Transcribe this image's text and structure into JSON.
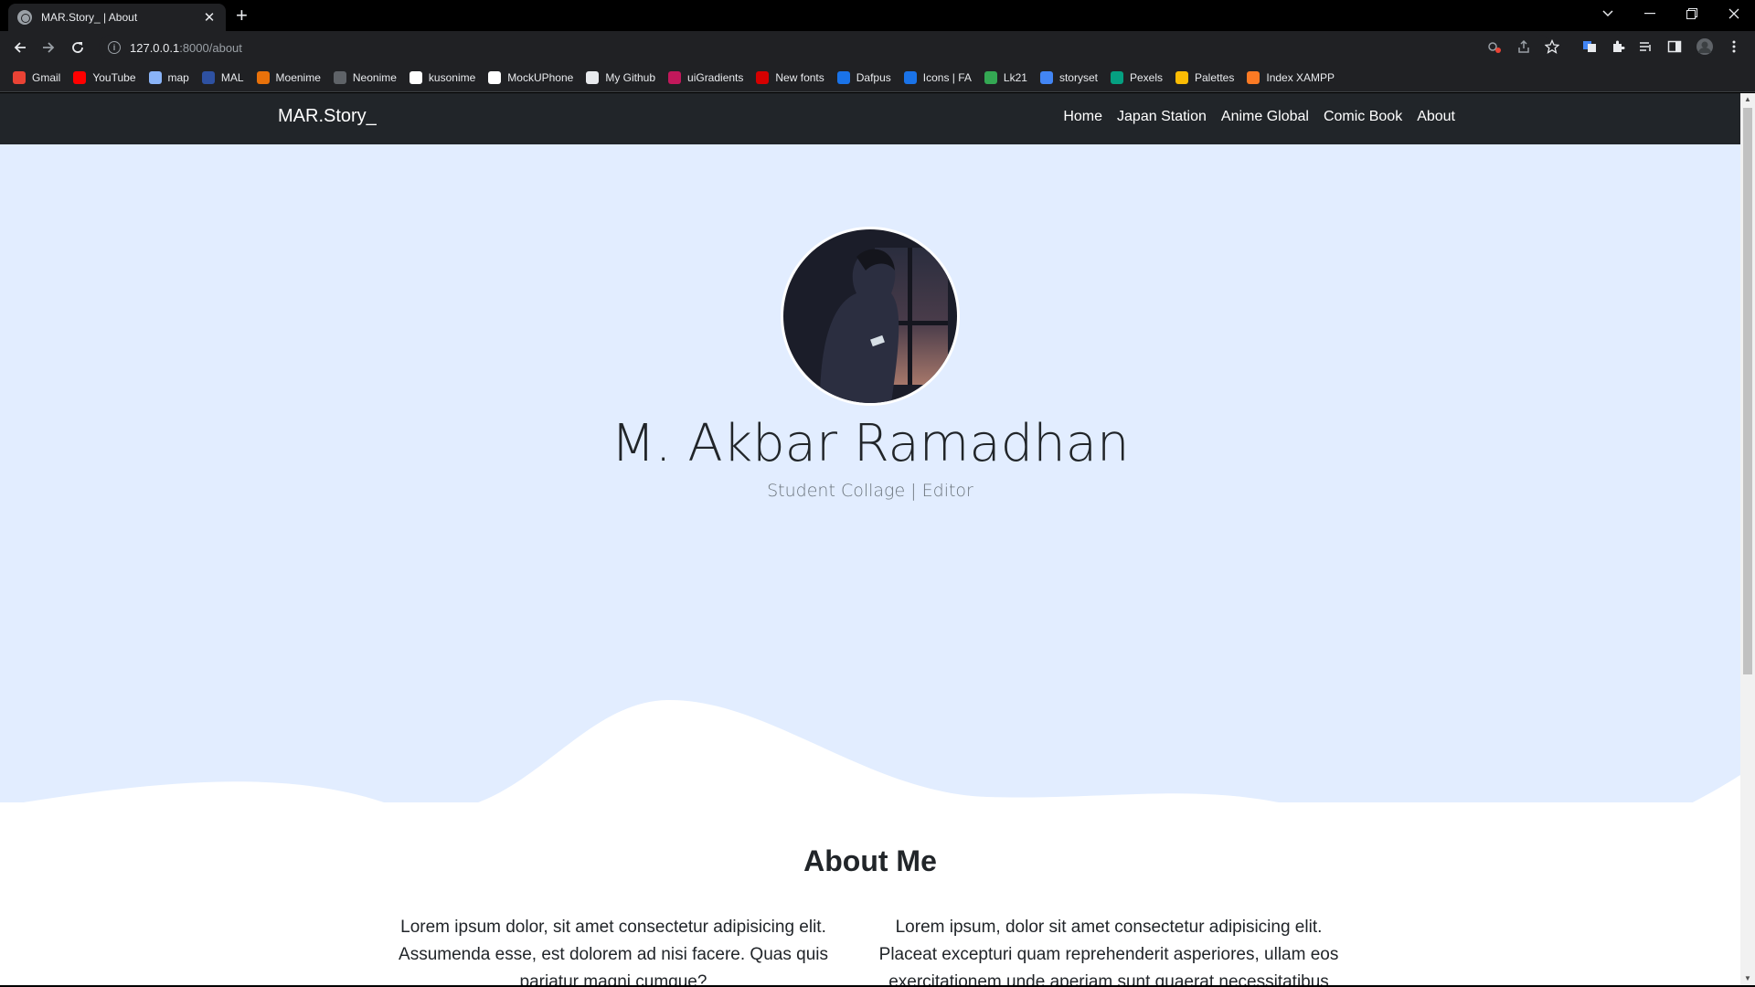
{
  "browser": {
    "tab_title": "MAR.Story_ | About",
    "tab_close": "✕",
    "new_tab": "+",
    "url_host": "127.0.0.1",
    "url_rest": ":8000/about",
    "bookmarks": [
      {
        "label": "Gmail",
        "color": "#ea4335"
      },
      {
        "label": "YouTube",
        "color": "#ff0000"
      },
      {
        "label": "map",
        "color": "#8ab4f8"
      },
      {
        "label": "MAL",
        "color": "#2e51a2"
      },
      {
        "label": "Moenime",
        "color": "#e8710a"
      },
      {
        "label": "Neonime",
        "color": "#5f6368"
      },
      {
        "label": "kusonime",
        "color": "#ffffff"
      },
      {
        "label": "MockUPhone",
        "color": "#ffffff"
      },
      {
        "label": "My Github",
        "color": "#e8eaed"
      },
      {
        "label": "uiGradients",
        "color": "#c2185b"
      },
      {
        "label": "New fonts",
        "color": "#d50000"
      },
      {
        "label": "Dafpus",
        "color": "#1a73e8"
      },
      {
        "label": "Icons | FA",
        "color": "#1a73e8"
      },
      {
        "label": "Lk21",
        "color": "#34a853"
      },
      {
        "label": "storyset",
        "color": "#4285f4"
      },
      {
        "label": "Pexels",
        "color": "#05a081"
      },
      {
        "label": "Palettes",
        "color": "#fbbc04"
      },
      {
        "label": "Index XAMPP",
        "color": "#fb7a24"
      }
    ]
  },
  "site": {
    "brand": "MAR.Story_",
    "nav": [
      "Home",
      "Japan Station",
      "Anime Global",
      "Comic Book",
      "About"
    ],
    "hero": {
      "name": "M. Akbar Ramadhan",
      "subtitle": "Student Collage | Editor"
    },
    "about": {
      "title": "About Me",
      "col_left": "Lorem ipsum dolor, sit amet consectetur adipisicing elit. Assumenda esse, est dolorem ad nisi facere. Quas quis pariatur magni cumque?",
      "col_right": "Lorem ipsum, dolor sit amet consectetur adipisicing elit. Placeat excepturi quam reprehenderit asperiores, ullam eos exercitationem unde aperiam sunt quaerat necessitatibus"
    }
  },
  "colors": {
    "navbar": "#212529",
    "hero_bg": "#e2edff",
    "page_bg": "#ffffff"
  }
}
